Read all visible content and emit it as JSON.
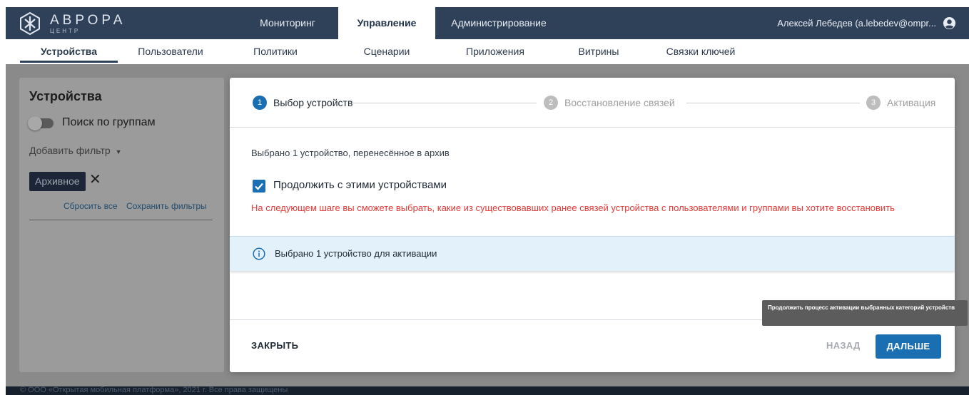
{
  "header": {
    "logo_title": "АВРОРА",
    "logo_subtitle": "ЦЕНТР",
    "tabs": [
      {
        "label": "Мониторинг",
        "active": false
      },
      {
        "label": "Управление",
        "active": true
      },
      {
        "label": "Администрирование",
        "active": false
      }
    ],
    "user": "Алексей Лебедев (a.lebedev@ompr..."
  },
  "subnav": {
    "items": [
      {
        "label": "Устройства",
        "active": true
      },
      {
        "label": "Пользователи",
        "active": false
      },
      {
        "label": "Политики",
        "active": false
      },
      {
        "label": "Сценарии",
        "active": false
      },
      {
        "label": "Приложения",
        "active": false
      },
      {
        "label": "Витрины",
        "active": false
      },
      {
        "label": "Связки ключей",
        "active": false
      }
    ]
  },
  "sidebar": {
    "title": "Устройства",
    "group_search_label": "Поиск по группам",
    "add_filter_label": "Добавить фильтр",
    "filter_chip": "Архивное",
    "reset_all": "Сбросить все",
    "save_filters": "Сохранить фильтры"
  },
  "modal": {
    "steps": [
      {
        "number": "1",
        "label": "Выбор устройств",
        "active": true
      },
      {
        "number": "2",
        "label": "Восстановление связей",
        "active": false
      },
      {
        "number": "3",
        "label": "Активация",
        "active": false
      }
    ],
    "selected_text": "Выбрано 1 устройство, перенесённое в архив",
    "checkbox_label": "Продолжить с этими устройствами",
    "checkbox_checked": true,
    "warning": "На следующем шаге вы сможете выбрать, какие из существовавших ранее связей устройства с пользователями и группами вы хотите восстановить",
    "info": "Выбрано 1 устройство для активации",
    "close_label": "ЗАКРЫТЬ",
    "back_label": "НАЗАД",
    "next_label": "ДАЛЬШЕ",
    "tooltip": "Продолжить процесс активации выбранных категорий устройств"
  },
  "footer": {
    "text": "© ООО «Открытая мобильная платформа», 2021 г. Все права защищены"
  },
  "colors": {
    "header_bg": "#2f4059",
    "primary": "#1a6fb3",
    "warning": "#e53935",
    "info_bg": "#e3f1fb"
  }
}
